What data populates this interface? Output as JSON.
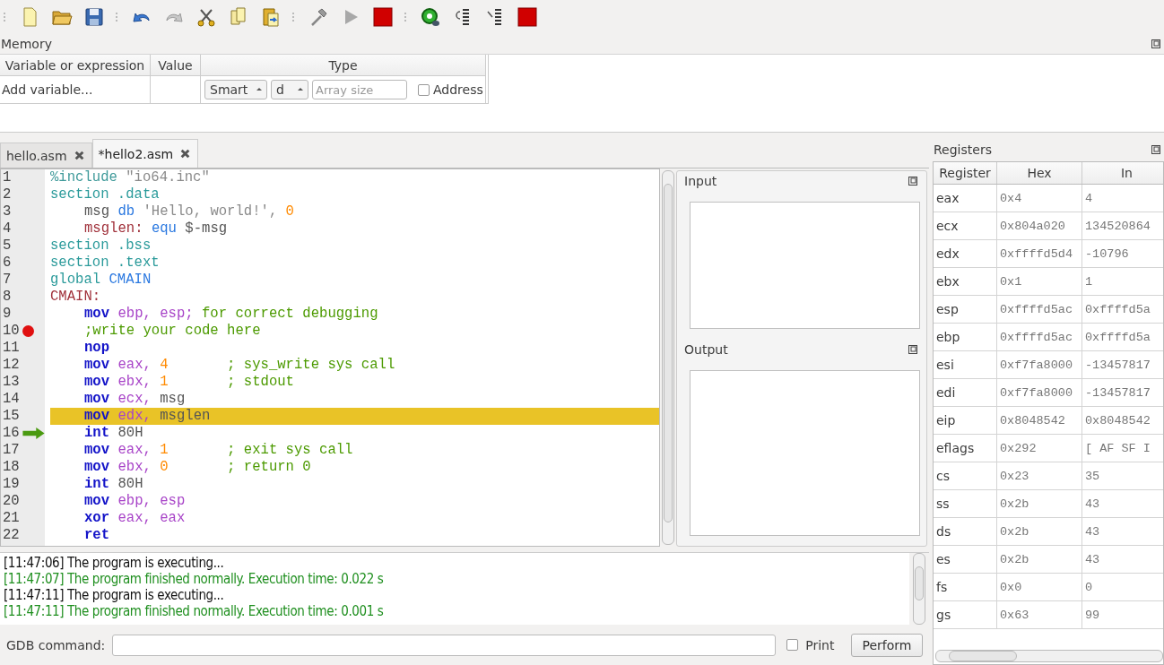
{
  "memory": {
    "title": "Memory",
    "columns": [
      "Variable or expression",
      "Value",
      "Type"
    ],
    "row": {
      "expression": "Add variable...",
      "type": "Smart",
      "format": "d",
      "array_size_placeholder": "Array size",
      "address_label": "Address",
      "address_checked": false
    }
  },
  "tabs": [
    {
      "label": "hello.asm",
      "selected": false
    },
    {
      "label": "*hello2.asm",
      "selected": true
    }
  ],
  "code": [
    {
      "number": "1",
      "indented": false,
      "breakpoint": false,
      "current": false,
      "highlighted": false,
      "tokens": [
        {
          "kind": "preproc",
          "text": "%include "
        },
        {
          "kind": "string",
          "text": "\"io64.inc\""
        }
      ]
    },
    {
      "number": "2",
      "indented": false,
      "breakpoint": false,
      "current": false,
      "highlighted": false,
      "tokens": [
        {
          "kind": "section",
          "text": "section .data"
        }
      ]
    },
    {
      "number": "3",
      "indented": true,
      "breakpoint": false,
      "current": false,
      "highlighted": false,
      "tokens": [
        {
          "kind": "plain",
          "text": "msg "
        },
        {
          "kind": "directive",
          "text": "db"
        },
        {
          "kind": "string",
          "text": " 'Hello, world!', "
        },
        {
          "kind": "number",
          "text": "0"
        }
      ]
    },
    {
      "number": "4",
      "indented": true,
      "breakpoint": false,
      "current": false,
      "highlighted": false,
      "tokens": [
        {
          "kind": "label",
          "text": "msglen: "
        },
        {
          "kind": "directive",
          "text": "equ"
        },
        {
          "kind": "plain",
          "text": " $-msg"
        }
      ]
    },
    {
      "number": "5",
      "indented": false,
      "breakpoint": false,
      "current": false,
      "highlighted": false,
      "tokens": [
        {
          "kind": "section",
          "text": "section .bss"
        }
      ]
    },
    {
      "number": "6",
      "indented": false,
      "breakpoint": false,
      "current": false,
      "highlighted": false,
      "tokens": [
        {
          "kind": "section",
          "text": "section .text"
        }
      ]
    },
    {
      "number": "7",
      "indented": false,
      "breakpoint": false,
      "current": false,
      "highlighted": false,
      "tokens": [
        {
          "kind": "section",
          "text": "global "
        },
        {
          "kind": "directive",
          "text": "CMAIN"
        }
      ]
    },
    {
      "number": "8",
      "indented": false,
      "breakpoint": false,
      "current": false,
      "highlighted": false,
      "tokens": [
        {
          "kind": "label",
          "text": "CMAIN:"
        }
      ]
    },
    {
      "number": "9",
      "indented": true,
      "breakpoint": false,
      "current": false,
      "highlighted": false,
      "tokens": [
        {
          "kind": "instruction",
          "text": "mov"
        },
        {
          "kind": "register",
          "text": " ebp, esp;"
        },
        {
          "kind": "comment",
          "text": " for correct debugging"
        }
      ]
    },
    {
      "number": "10",
      "indented": true,
      "breakpoint": true,
      "current": false,
      "highlighted": false,
      "tokens": [
        {
          "kind": "comment",
          "text": ";write your code here"
        }
      ]
    },
    {
      "number": "11",
      "indented": true,
      "breakpoint": false,
      "current": false,
      "highlighted": false,
      "tokens": [
        {
          "kind": "instruction",
          "text": "nop"
        }
      ]
    },
    {
      "number": "12",
      "indented": true,
      "breakpoint": false,
      "current": false,
      "highlighted": false,
      "tokens": [
        {
          "kind": "instruction",
          "text": "mov"
        },
        {
          "kind": "register",
          "text": " eax, "
        },
        {
          "kind": "number",
          "text": "4"
        },
        {
          "kind": "comment",
          "text": "       ; sys_write sys call"
        }
      ]
    },
    {
      "number": "13",
      "indented": true,
      "breakpoint": false,
      "current": false,
      "highlighted": false,
      "tokens": [
        {
          "kind": "instruction",
          "text": "mov"
        },
        {
          "kind": "register",
          "text": " ebx, "
        },
        {
          "kind": "number",
          "text": "1"
        },
        {
          "kind": "comment",
          "text": "       ; stdout"
        }
      ]
    },
    {
      "number": "14",
      "indented": true,
      "breakpoint": false,
      "current": false,
      "highlighted": false,
      "tokens": [
        {
          "kind": "instruction",
          "text": "mov"
        },
        {
          "kind": "register",
          "text": " ecx, "
        },
        {
          "kind": "plain",
          "text": "msg"
        }
      ]
    },
    {
      "number": "15",
      "indented": true,
      "breakpoint": false,
      "current": false,
      "highlighted": true,
      "tokens": [
        {
          "kind": "instruction",
          "text": "mov"
        },
        {
          "kind": "register",
          "text": " edx, "
        },
        {
          "kind": "plain",
          "text": "msglen"
        }
      ]
    },
    {
      "number": "16",
      "indented": true,
      "breakpoint": false,
      "current": true,
      "highlighted": false,
      "tokens": [
        {
          "kind": "instruction",
          "text": "int"
        },
        {
          "kind": "plain",
          "text": " 80H"
        }
      ]
    },
    {
      "number": "17",
      "indented": true,
      "breakpoint": false,
      "current": false,
      "highlighted": false,
      "tokens": [
        {
          "kind": "instruction",
          "text": "mov"
        },
        {
          "kind": "register",
          "text": " eax, "
        },
        {
          "kind": "number",
          "text": "1"
        },
        {
          "kind": "comment",
          "text": "       ; exit sys call"
        }
      ]
    },
    {
      "number": "18",
      "indented": true,
      "breakpoint": false,
      "current": false,
      "highlighted": false,
      "tokens": [
        {
          "kind": "instruction",
          "text": "mov"
        },
        {
          "kind": "register",
          "text": " ebx, "
        },
        {
          "kind": "number",
          "text": "0"
        },
        {
          "kind": "comment",
          "text": "       ; return 0"
        }
      ]
    },
    {
      "number": "19",
      "indented": true,
      "breakpoint": false,
      "current": false,
      "highlighted": false,
      "tokens": [
        {
          "kind": "instruction",
          "text": "int"
        },
        {
          "kind": "plain",
          "text": " 80H"
        }
      ]
    },
    {
      "number": "20",
      "indented": true,
      "breakpoint": false,
      "current": false,
      "highlighted": false,
      "tokens": [
        {
          "kind": "instruction",
          "text": "mov"
        },
        {
          "kind": "register",
          "text": " ebp, esp"
        }
      ]
    },
    {
      "number": "21",
      "indented": true,
      "breakpoint": false,
      "current": false,
      "highlighted": false,
      "tokens": [
        {
          "kind": "instruction",
          "text": "xor"
        },
        {
          "kind": "register",
          "text": " eax, eax"
        }
      ]
    },
    {
      "number": "22",
      "indented": true,
      "breakpoint": false,
      "current": false,
      "highlighted": false,
      "tokens": [
        {
          "kind": "instruction",
          "text": "ret"
        }
      ]
    }
  ],
  "input": {
    "title": "Input"
  },
  "output": {
    "title": "Output"
  },
  "log": [
    {
      "kind": "info",
      "text": "[11:47:06] The program is executing..."
    },
    {
      "kind": "success",
      "text": "[11:47:07] The program finished normally. Execution time: 0.022 s"
    },
    {
      "kind": "info",
      "text": "[11:47:11] The program is executing..."
    },
    {
      "kind": "success",
      "text": "[11:47:11] The program finished normally. Execution time: 0.001 s"
    }
  ],
  "gdb": {
    "label": "GDB command:",
    "print_label": "Print",
    "print_checked": false,
    "button": "Perform"
  },
  "registers": {
    "title": "Registers",
    "columns": [
      "Register",
      "Hex",
      "In"
    ],
    "rows": [
      {
        "name": "eax",
        "hex": "0x4",
        "value": "4"
      },
      {
        "name": "ecx",
        "hex": "0x804a020",
        "value": "134520864"
      },
      {
        "name": "edx",
        "hex": "0xffffd5d4",
        "value": "-10796"
      },
      {
        "name": "ebx",
        "hex": "0x1",
        "value": "1"
      },
      {
        "name": "esp",
        "hex": "0xffffd5ac",
        "value": "0xffffd5a"
      },
      {
        "name": "ebp",
        "hex": "0xffffd5ac",
        "value": "0xffffd5a"
      },
      {
        "name": "esi",
        "hex": "0xf7fa8000",
        "value": "-13457817"
      },
      {
        "name": "edi",
        "hex": "0xf7fa8000",
        "value": "-13457817"
      },
      {
        "name": "eip",
        "hex": "0x8048542",
        "value": "0x8048542"
      },
      {
        "name": "eflags",
        "hex": "0x292",
        "value": "[ AF SF I"
      },
      {
        "name": "cs",
        "hex": "0x23",
        "value": "35"
      },
      {
        "name": "ss",
        "hex": "0x2b",
        "value": "43"
      },
      {
        "name": "ds",
        "hex": "0x2b",
        "value": "43"
      },
      {
        "name": "es",
        "hex": "0x2b",
        "value": "43"
      },
      {
        "name": "fs",
        "hex": "0x0",
        "value": "0"
      },
      {
        "name": "gs",
        "hex": "0x63",
        "value": "99"
      }
    ]
  }
}
